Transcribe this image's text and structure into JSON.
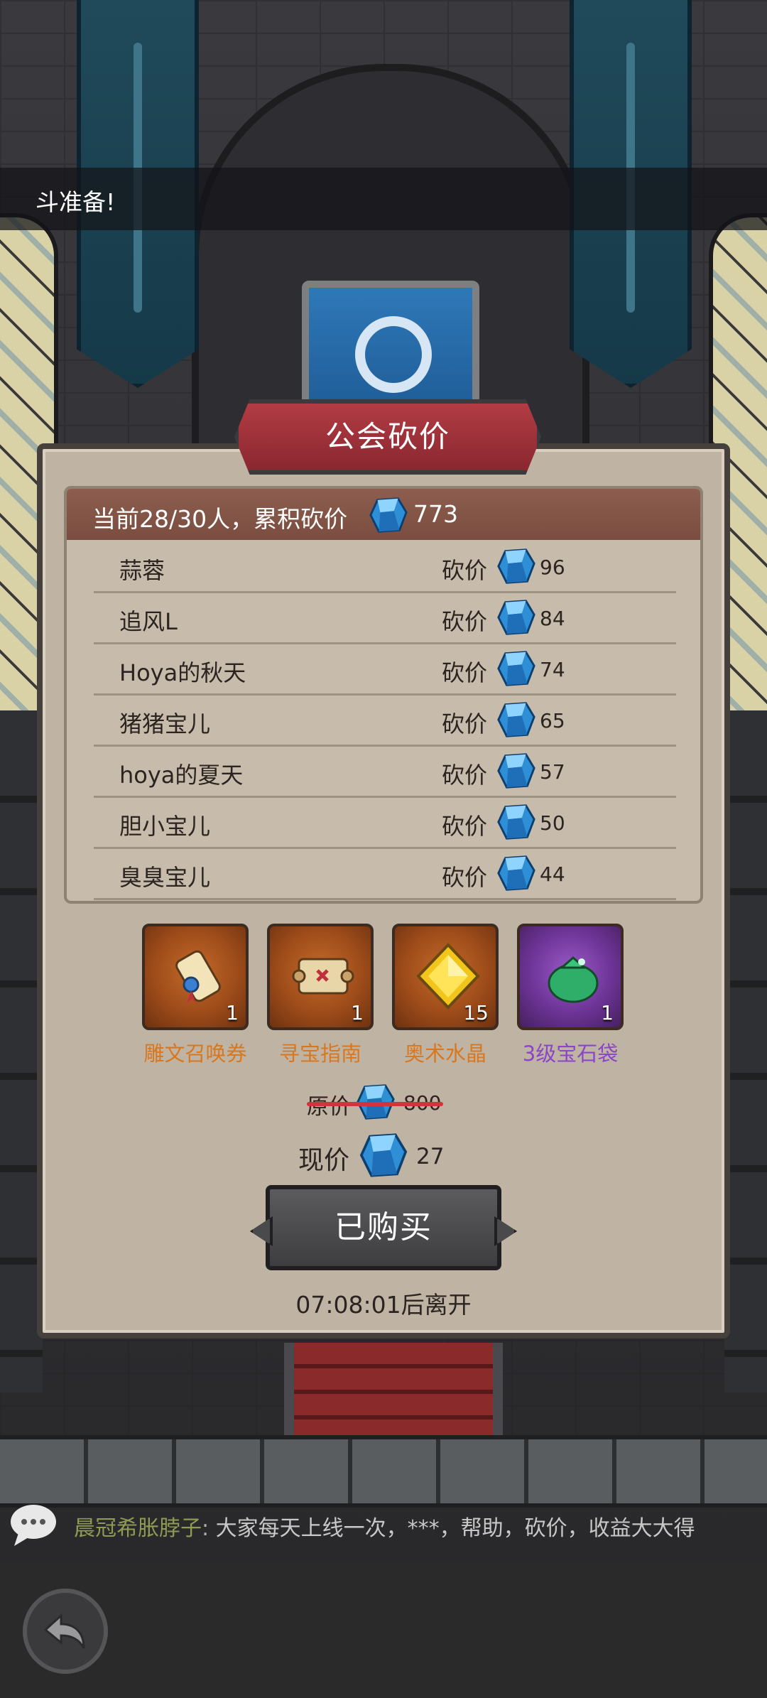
{
  "toast": {
    "text": "斗准备!"
  },
  "dialog": {
    "title": "公会砍价"
  },
  "summary": {
    "prefix": "当前28/30人，累积砍价",
    "total": "773"
  },
  "bargain_label": "砍价",
  "members": [
    {
      "name": "蒜蓉",
      "amount": "96"
    },
    {
      "name": "追风L",
      "amount": "84"
    },
    {
      "name": "Hoya的秋天",
      "amount": "74"
    },
    {
      "name": "猪猪宝儿",
      "amount": "65"
    },
    {
      "name": "hoya的夏天",
      "amount": "57"
    },
    {
      "name": "胆小宝儿",
      "amount": "50"
    },
    {
      "name": "臭臭宝儿",
      "amount": "44"
    }
  ],
  "rewards": [
    {
      "name": "雕文召唤券",
      "qty": "1",
      "icon": "scroll-ticket-icon"
    },
    {
      "name": "寻宝指南",
      "qty": "1",
      "icon": "treasure-map-icon"
    },
    {
      "name": "奥术水晶",
      "qty": "15",
      "icon": "yellow-crystal-icon"
    },
    {
      "name": "3级宝石袋",
      "qty": "1",
      "icon": "gem-bag-icon"
    }
  ],
  "price": {
    "original_label": "原价",
    "original_value": "800",
    "current_label": "现价",
    "current_value": "27"
  },
  "buy_button": {
    "label": "已购买"
  },
  "timer": {
    "text": "07:08:01后离开"
  },
  "chat": {
    "user": "晨冠希胀脖子",
    "separator": ": ",
    "message": "大家每天上线一次，***，帮助，砍价，收益大大得"
  },
  "colors": {
    "accent_orange": "#d9771f",
    "accent_purple": "#8a45c8",
    "gem_blue": "#39a6e8",
    "header_brown": "#8d5e4f",
    "title_red": "#b23c44"
  }
}
